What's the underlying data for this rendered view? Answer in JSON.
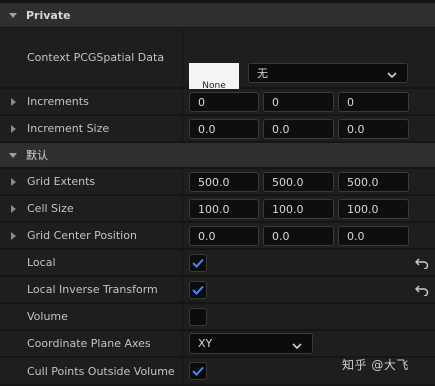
{
  "sections": [
    {
      "title": "Private"
    },
    {
      "title": "默认"
    }
  ],
  "context_spatial": {
    "label": "Context PCGSpatial Data",
    "thumbnail_text": "None",
    "asset_value": "无"
  },
  "increments": {
    "label": "Increments",
    "x": "0",
    "y": "0",
    "z": "0"
  },
  "increment_size": {
    "label": "Increment Size",
    "x": "0.0",
    "y": "0.0",
    "z": "0.0"
  },
  "grid_extents": {
    "label": "Grid Extents",
    "x": "500.0",
    "y": "500.0",
    "z": "500.0"
  },
  "cell_size": {
    "label": "Cell Size",
    "x": "100.0",
    "y": "100.0",
    "z": "100.0"
  },
  "grid_center": {
    "label": "Grid Center Position",
    "x": "0.0",
    "y": "0.0",
    "z": "0.0"
  },
  "local": {
    "label": "Local",
    "checked": true
  },
  "local_inverse": {
    "label": "Local Inverse Transform",
    "checked": true
  },
  "volume": {
    "label": "Volume",
    "checked": false
  },
  "plane_axes": {
    "label": "Coordinate Plane Axes",
    "value": "XY"
  },
  "cull_points": {
    "label": "Cull Points Outside Volume",
    "checked": true
  },
  "watermark": "知乎 @大飞",
  "colors": {
    "accent": "#3d8bff",
    "panel": "#1e1e1e",
    "header": "#2f2f2f"
  }
}
